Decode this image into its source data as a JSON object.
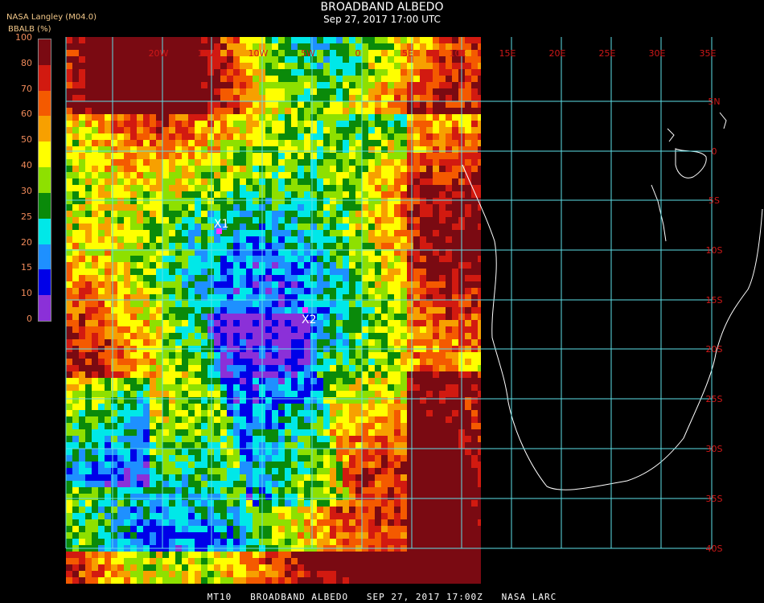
{
  "header": {
    "title": "BROADBAND ALBEDO",
    "subtitle": "Sep 27, 2017 17:00 UTC",
    "source": "NASA Langley (M04.0)",
    "colorbar_label": "BBALB (%)"
  },
  "colorbar": {
    "ticks": [
      "100",
      "80",
      "70",
      "60",
      "50",
      "40",
      "30",
      "25",
      "20",
      "15",
      "10",
      "0"
    ],
    "colors": [
      "#7a0a12",
      "#d21a10",
      "#f45a00",
      "#f7a000",
      "#ffff00",
      "#8ee000",
      "#0a8a0a",
      "#00e8e8",
      "#1e90ff",
      "#0000e8",
      "#8b30d8"
    ]
  },
  "grid": {
    "lon_labels": [
      "20W",
      "15W",
      "10W",
      "5W",
      "0",
      "5E",
      "10E",
      "15E",
      "20E",
      "25E",
      "30E",
      "35E"
    ],
    "lat_labels": [
      "5N",
      "0",
      "5S",
      "10S",
      "15S",
      "20S",
      "25S",
      "30S",
      "35S",
      "40S"
    ]
  },
  "markers": [
    {
      "label": "X1",
      "color": "#ff30ff"
    },
    {
      "label": "X2",
      "color": "#ff30ff"
    }
  ],
  "footer": "MT10   BROADBAND ALBEDO   SEP 27, 2017 17:00Z   NASA LARC"
}
